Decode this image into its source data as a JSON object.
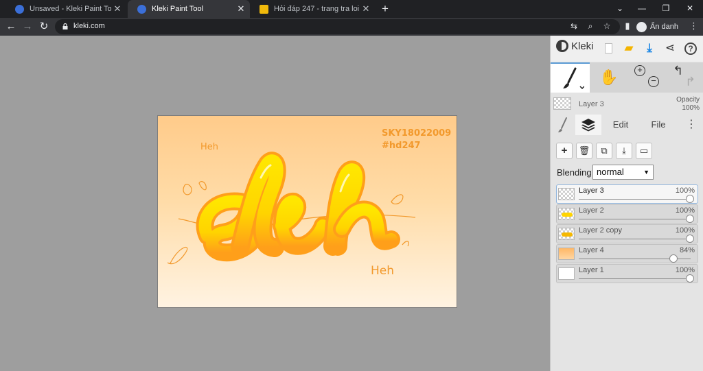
{
  "browser": {
    "tabs": [
      {
        "title": "Unsaved - Kleki Paint Tool",
        "favicon_color": "#3b6fd8",
        "active": false
      },
      {
        "title": "Kleki Paint Tool",
        "favicon_color": "#3b6fd8",
        "active": true
      },
      {
        "title": "Hỏi đáp 247 - trang tra loi",
        "favicon_color": "#f0b90b",
        "active": false
      }
    ],
    "new_tab": "+",
    "address": "kleki.com",
    "profile_label": "Ẩn danh"
  },
  "canvas_art": {
    "big_word": "leh",
    "watermark_line1": "SKY18022009",
    "watermark_line2": "#hd247",
    "small_text_1": "Heh",
    "small_text_2": "Heh"
  },
  "panel": {
    "brand": "Kleki",
    "current_layer": "Layer 3",
    "opacity_label": "Opacity",
    "opacity_value": "100%",
    "tabs": {
      "edit": "Edit",
      "file": "File"
    },
    "blending_label": "Blending",
    "blending_value": "normal",
    "layers": [
      {
        "name": "Layer 3",
        "opacity": "100%",
        "value": 1.0,
        "selected": true,
        "thumb": "transparent"
      },
      {
        "name": "Layer 2",
        "opacity": "100%",
        "value": 1.0,
        "selected": false,
        "thumb": "yellow"
      },
      {
        "name": "Layer 2 copy",
        "opacity": "100%",
        "value": 1.0,
        "selected": false,
        "thumb": "yellow"
      },
      {
        "name": "Layer 4",
        "opacity": "84%",
        "value": 0.84,
        "selected": false,
        "thumb": "orange"
      },
      {
        "name": "Layer 1",
        "opacity": "100%",
        "value": 1.0,
        "selected": false,
        "thumb": "white"
      }
    ]
  },
  "colors": {
    "accent": "#5b9bd5",
    "download": "#1e88e5",
    "folder": "#f4b400",
    "art_orange": "#f2992c",
    "art_yellow": "#ffe000"
  }
}
